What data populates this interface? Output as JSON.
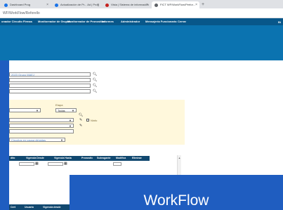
{
  "browser": {
    "tabs": [
      {
        "label": "Dashboard Prog",
        "active": false,
        "favicon_color": "#1a73e8"
      },
      {
        "label": "Actualización de Pr... Ad | Prog",
        "active": false,
        "favicon_color": "#1a73e8"
      },
      {
        "label": "Vista | Sistema de información",
        "active": false,
        "favicon_color": "#c5221f"
      },
      {
        "label": "FICT WF/WorkFlow/Perfor...",
        "active": true,
        "favicon_color": "#5f6368"
      }
    ],
    "close_glyph": "×",
    "new_tab_glyph": "+",
    "address": "WF/WorkFlow/Reforello"
  },
  "menu": {
    "items": [
      "onador Circuito Firmas",
      "Monitoreador de Grupos",
      "Monitoreador de Pronostico",
      "Informes",
      "Administrador",
      "Mensajeria Funcionaria",
      "Cerrar"
    ],
    "right_text": "Bi"
  },
  "form": {
    "rows": [
      {
        "value": "2023 Grupo MAEJ"
      },
      {
        "value": ""
      },
      {
        "value": ""
      },
      {
        "value": ""
      }
    ],
    "lookup_glyph": "🔍︎"
  },
  "filters": {
    "left_select": "",
    "right_label": "Etapa",
    "right_select": "Todas",
    "select_rows": [
      "",
      "",
      ""
    ],
    "checkbox_label": "Ninfo",
    "pending_select": "Circuitos en pausa dirigidas"
  },
  "grid": {
    "columns": [
      "dito",
      "Vigencia Desde",
      "Vigencia Hasta",
      "Pronostic",
      "Subrogante",
      "Modifica",
      "Eliminar"
    ],
    "calendar_glyph": "▦"
  },
  "bottom_grid": {
    "columns": [
      "Cert",
      "Usuario",
      "Vigencia desde"
    ]
  },
  "overlay": {
    "title": "WorkFlow",
    "color": "#1f5dc0"
  },
  "colors": {
    "menubar": "#08578a",
    "banner": "#0b73b0",
    "grid_header": "#11486f",
    "filter_panel": "#fff8dc"
  }
}
